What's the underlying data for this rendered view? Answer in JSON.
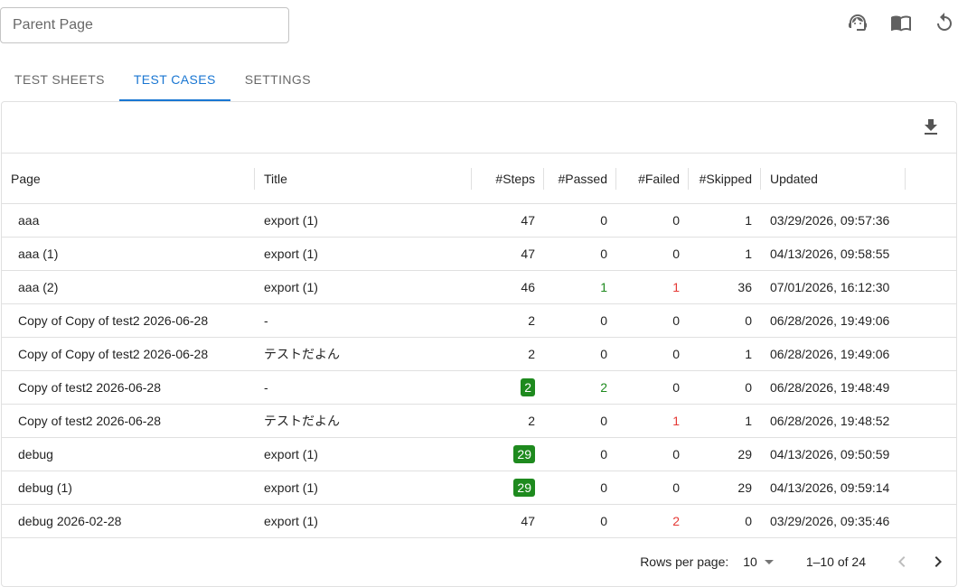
{
  "header": {
    "parent_placeholder": "Parent Page",
    "icons": [
      "support-agent-icon",
      "book-icon",
      "refresh-icon"
    ]
  },
  "tabs": [
    {
      "label": "TEST SHEETS",
      "active": false
    },
    {
      "label": "TEST CASES",
      "active": true
    },
    {
      "label": "SETTINGS",
      "active": false
    }
  ],
  "toolbar": {
    "download_icon": "download-icon"
  },
  "columns": {
    "page": "Page",
    "title": "Title",
    "steps": "#Steps",
    "passed": "#Passed",
    "failed": "#Failed",
    "skipped": "#Skipped",
    "updated": "Updated"
  },
  "rows": [
    {
      "page": "aaa",
      "title": "export (1)",
      "steps": "47",
      "passed": "0",
      "failed": "0",
      "skipped": "1",
      "updated": "03/29/2026, 09:57:36"
    },
    {
      "page": "aaa (1)",
      "title": "export (1)",
      "steps": "47",
      "passed": "0",
      "failed": "0",
      "skipped": "1",
      "updated": "04/13/2026, 09:58:55"
    },
    {
      "page": "aaa (2)",
      "title": "export (1)",
      "steps": "46",
      "passed": "1",
      "failed": "1",
      "skipped": "36",
      "updated": "07/01/2026, 16:12:30"
    },
    {
      "page": "Copy of Copy of test2 2026-06-28",
      "title": "-",
      "steps": "2",
      "passed": "0",
      "failed": "0",
      "skipped": "0",
      "updated": "06/28/2026, 19:49:06"
    },
    {
      "page": "Copy of Copy of test2 2026-06-28",
      "title": "テストだよん",
      "steps": "2",
      "passed": "0",
      "failed": "0",
      "skipped": "1",
      "updated": "06/28/2026, 19:49:06"
    },
    {
      "page": "Copy of test2 2026-06-28",
      "title": "-",
      "steps": "2",
      "passed": "2",
      "failed": "0",
      "skipped": "0",
      "updated": "06/28/2026, 19:48:49"
    },
    {
      "page": "Copy of test2 2026-06-28",
      "title": "テストだよん",
      "steps": "2",
      "passed": "0",
      "failed": "1",
      "skipped": "1",
      "updated": "06/28/2026, 19:48:52"
    },
    {
      "page": "debug",
      "title": "export (1)",
      "steps": "29",
      "passed": "0",
      "failed": "0",
      "skipped": "29",
      "updated": "04/13/2026, 09:50:59"
    },
    {
      "page": "debug (1)",
      "title": "export (1)",
      "steps": "29",
      "passed": "0",
      "failed": "0",
      "skipped": "29",
      "updated": "04/13/2026, 09:59:14"
    },
    {
      "page": "debug 2026-02-28",
      "title": "export (1)",
      "steps": "47",
      "passed": "0",
      "failed": "2",
      "skipped": "0",
      "updated": "03/29/2026, 09:35:46"
    }
  ],
  "pagination": {
    "rows_per_page_label": "Rows per page:",
    "rows_per_page": "10",
    "range": "1–10 of 24"
  },
  "colors": {
    "accent": "#1976d2",
    "pass": "#1e8a1e",
    "fail": "#e53935"
  }
}
